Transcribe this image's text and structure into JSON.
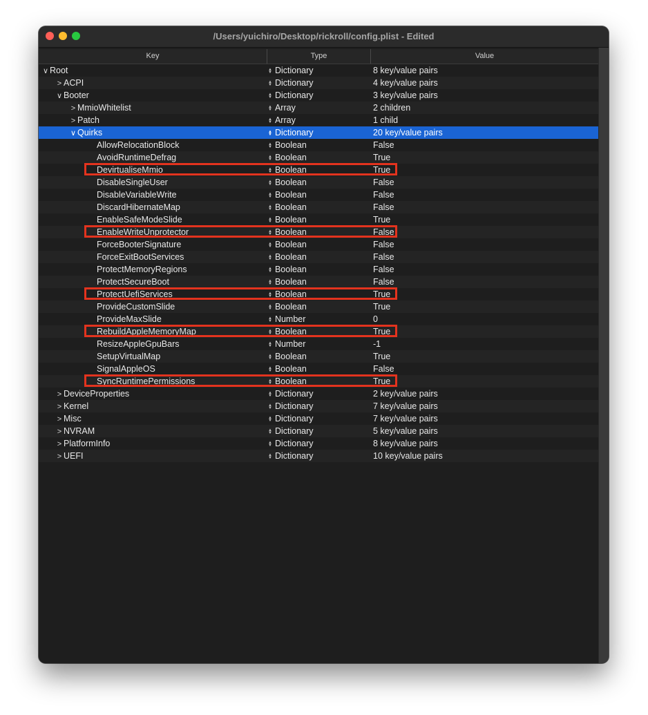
{
  "window": {
    "title": "/Users/yuichiro/Desktop/rickroll/config.plist - Edited"
  },
  "columns": {
    "key": "Key",
    "type": "Type",
    "value": "Value"
  },
  "colors": {
    "selection": "#1a64d4",
    "highlight": "#e3331e"
  },
  "rows": [
    {
      "key": "Root",
      "type": "Dictionary",
      "value": "8 key/value pairs",
      "level": 0,
      "disclosure": "expanded",
      "selected": false,
      "highlighted": false
    },
    {
      "key": "ACPI",
      "type": "Dictionary",
      "value": "4 key/value pairs",
      "level": 1,
      "disclosure": "collapsed",
      "selected": false,
      "highlighted": false
    },
    {
      "key": "Booter",
      "type": "Dictionary",
      "value": "3 key/value pairs",
      "level": 1,
      "disclosure": "expanded",
      "selected": false,
      "highlighted": false
    },
    {
      "key": "MmioWhitelist",
      "type": "Array",
      "value": "2 children",
      "level": 2,
      "disclosure": "collapsed",
      "selected": false,
      "highlighted": false
    },
    {
      "key": "Patch",
      "type": "Array",
      "value": "1 child",
      "level": 2,
      "disclosure": "collapsed",
      "selected": false,
      "highlighted": false
    },
    {
      "key": "Quirks",
      "type": "Dictionary",
      "value": "20 key/value pairs",
      "level": 2,
      "disclosure": "expanded",
      "selected": true,
      "highlighted": false
    },
    {
      "key": "AllowRelocationBlock",
      "type": "Boolean",
      "value": "False",
      "level": 3,
      "disclosure": "none",
      "selected": false,
      "highlighted": false
    },
    {
      "key": "AvoidRuntimeDefrag",
      "type": "Boolean",
      "value": "True",
      "level": 3,
      "disclosure": "none",
      "selected": false,
      "highlighted": false
    },
    {
      "key": "DevirtualiseMmio",
      "type": "Boolean",
      "value": "True",
      "level": 3,
      "disclosure": "none",
      "selected": false,
      "highlighted": true
    },
    {
      "key": "DisableSingleUser",
      "type": "Boolean",
      "value": "False",
      "level": 3,
      "disclosure": "none",
      "selected": false,
      "highlighted": false
    },
    {
      "key": "DisableVariableWrite",
      "type": "Boolean",
      "value": "False",
      "level": 3,
      "disclosure": "none",
      "selected": false,
      "highlighted": false
    },
    {
      "key": "DiscardHibernateMap",
      "type": "Boolean",
      "value": "False",
      "level": 3,
      "disclosure": "none",
      "selected": false,
      "highlighted": false
    },
    {
      "key": "EnableSafeModeSlide",
      "type": "Boolean",
      "value": "True",
      "level": 3,
      "disclosure": "none",
      "selected": false,
      "highlighted": false
    },
    {
      "key": "EnableWriteUnprotector",
      "type": "Boolean",
      "value": "False",
      "level": 3,
      "disclosure": "none",
      "selected": false,
      "highlighted": true
    },
    {
      "key": "ForceBooterSignature",
      "type": "Boolean",
      "value": "False",
      "level": 3,
      "disclosure": "none",
      "selected": false,
      "highlighted": false
    },
    {
      "key": "ForceExitBootServices",
      "type": "Boolean",
      "value": "False",
      "level": 3,
      "disclosure": "none",
      "selected": false,
      "highlighted": false
    },
    {
      "key": "ProtectMemoryRegions",
      "type": "Boolean",
      "value": "False",
      "level": 3,
      "disclosure": "none",
      "selected": false,
      "highlighted": false
    },
    {
      "key": "ProtectSecureBoot",
      "type": "Boolean",
      "value": "False",
      "level": 3,
      "disclosure": "none",
      "selected": false,
      "highlighted": false
    },
    {
      "key": "ProtectUefiServices",
      "type": "Boolean",
      "value": "True",
      "level": 3,
      "disclosure": "none",
      "selected": false,
      "highlighted": true
    },
    {
      "key": "ProvideCustomSlide",
      "type": "Boolean",
      "value": "True",
      "level": 3,
      "disclosure": "none",
      "selected": false,
      "highlighted": false
    },
    {
      "key": "ProvideMaxSlide",
      "type": "Number",
      "value": "0",
      "level": 3,
      "disclosure": "none",
      "selected": false,
      "highlighted": false
    },
    {
      "key": "RebuildAppleMemoryMap",
      "type": "Boolean",
      "value": "True",
      "level": 3,
      "disclosure": "none",
      "selected": false,
      "highlighted": true
    },
    {
      "key": "ResizeAppleGpuBars",
      "type": "Number",
      "value": "-1",
      "level": 3,
      "disclosure": "none",
      "selected": false,
      "highlighted": false
    },
    {
      "key": "SetupVirtualMap",
      "type": "Boolean",
      "value": "True",
      "level": 3,
      "disclosure": "none",
      "selected": false,
      "highlighted": false
    },
    {
      "key": "SignalAppleOS",
      "type": "Boolean",
      "value": "False",
      "level": 3,
      "disclosure": "none",
      "selected": false,
      "highlighted": false
    },
    {
      "key": "SyncRuntimePermissions",
      "type": "Boolean",
      "value": "True",
      "level": 3,
      "disclosure": "none",
      "selected": false,
      "highlighted": true
    },
    {
      "key": "DeviceProperties",
      "type": "Dictionary",
      "value": "2 key/value pairs",
      "level": 1,
      "disclosure": "collapsed",
      "selected": false,
      "highlighted": false
    },
    {
      "key": "Kernel",
      "type": "Dictionary",
      "value": "7 key/value pairs",
      "level": 1,
      "disclosure": "collapsed",
      "selected": false,
      "highlighted": false
    },
    {
      "key": "Misc",
      "type": "Dictionary",
      "value": "7 key/value pairs",
      "level": 1,
      "disclosure": "collapsed",
      "selected": false,
      "highlighted": false
    },
    {
      "key": "NVRAM",
      "type": "Dictionary",
      "value": "5 key/value pairs",
      "level": 1,
      "disclosure": "collapsed",
      "selected": false,
      "highlighted": false
    },
    {
      "key": "PlatformInfo",
      "type": "Dictionary",
      "value": "8 key/value pairs",
      "level": 1,
      "disclosure": "collapsed",
      "selected": false,
      "highlighted": false
    },
    {
      "key": "UEFI",
      "type": "Dictionary",
      "value": "10 key/value pairs",
      "level": 1,
      "disclosure": "collapsed",
      "selected": false,
      "highlighted": false
    }
  ]
}
